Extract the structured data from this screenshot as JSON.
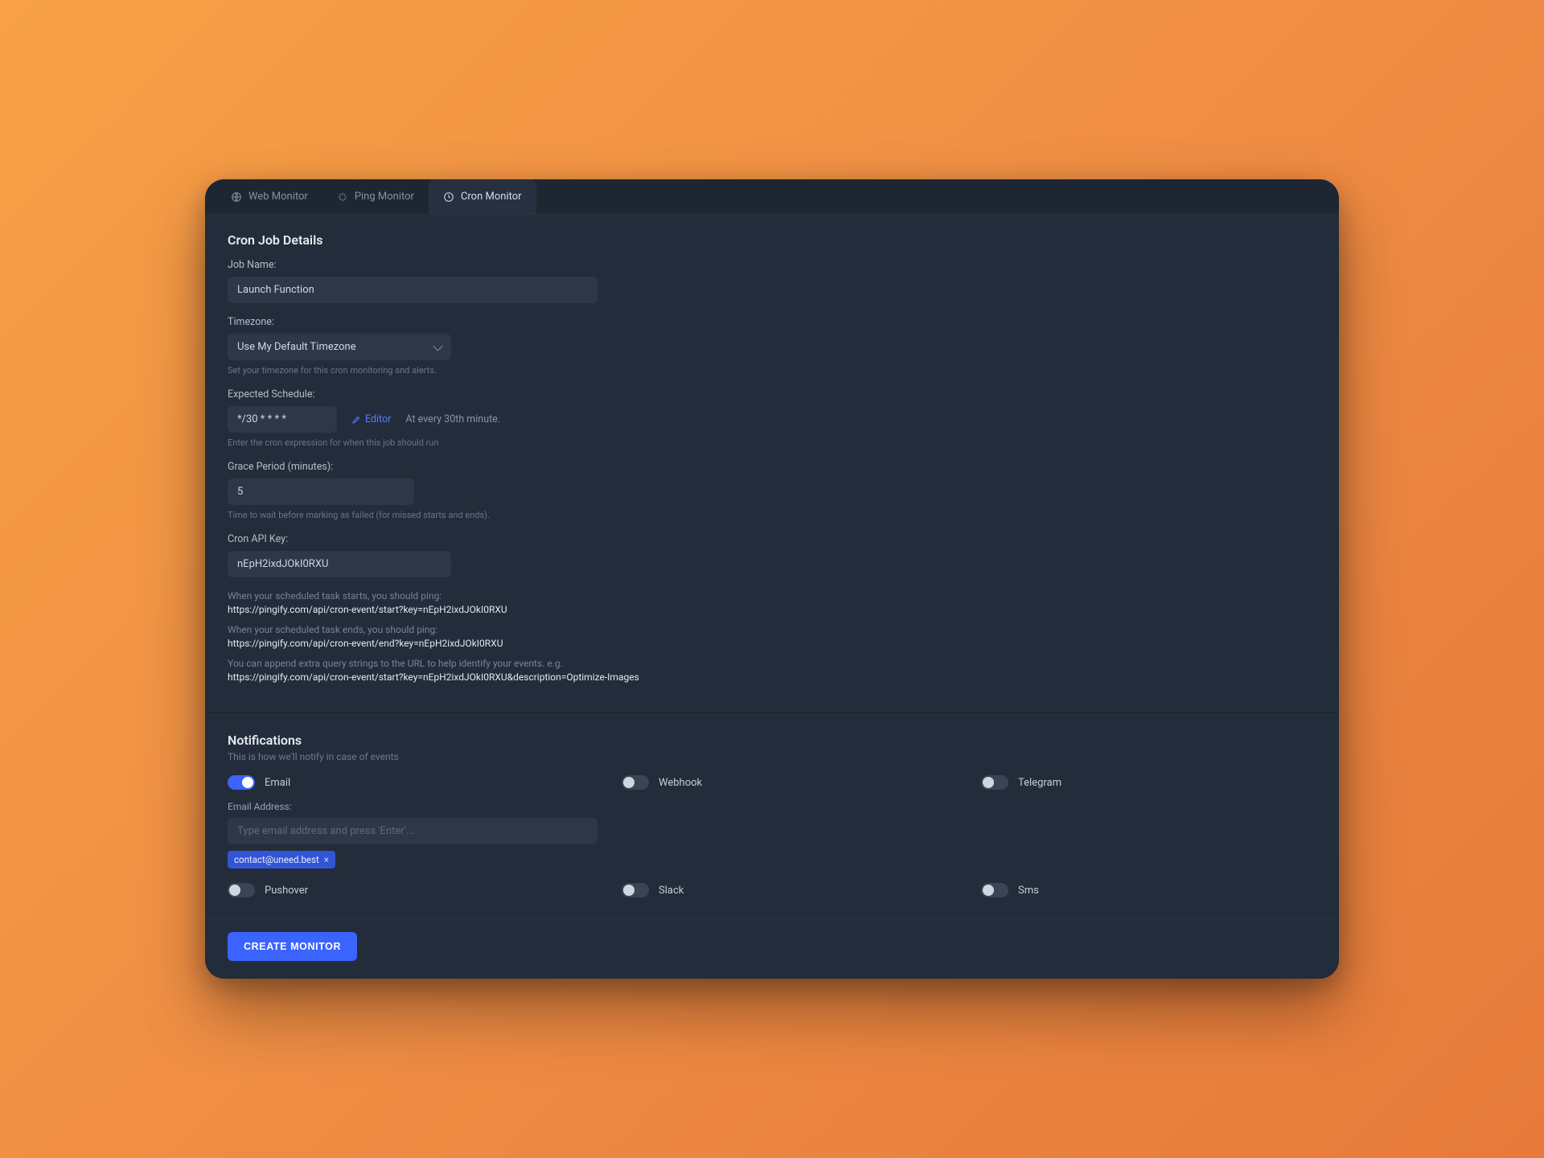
{
  "tabs": [
    {
      "label": "Web Monitor",
      "icon": "globe"
    },
    {
      "label": "Ping Monitor",
      "icon": "sparkle"
    },
    {
      "label": "Cron Monitor",
      "icon": "clock",
      "active": true
    }
  ],
  "details": {
    "heading": "Cron Job Details",
    "job_name": {
      "label": "Job Name:",
      "value": "Launch Function"
    },
    "timezone": {
      "label": "Timezone:",
      "selected": "Use My Default Timezone",
      "help": "Set your timezone for this cron monitoring and alerts."
    },
    "schedule": {
      "label": "Expected Schedule:",
      "value": "*/30 * * * *",
      "editor_link": "Editor",
      "description": "At every 30th minute.",
      "help": "Enter the cron expression for when this job should run"
    },
    "grace": {
      "label": "Grace Period (minutes):",
      "value": "5",
      "help": "Time to wait before marking as failed (for missed starts and ends)."
    },
    "api_key": {
      "label": "Cron API Key:",
      "value": "nEpH2ixdJOkI0RXU"
    },
    "api_info": {
      "start_label": "When your scheduled task starts, you should ping:",
      "start_url": "https://pingify.com/api/cron-event/start?key=nEpH2ixdJOkI0RXU",
      "end_label": "When your scheduled task ends, you should ping:",
      "end_url": "https://pingify.com/api/cron-event/end?key=nEpH2ixdJOkI0RXU",
      "extra_label": "You can append extra query strings to the URL to help identify your events. e.g.",
      "extra_url": "https://pingify.com/api/cron-event/start?key=nEpH2ixdJOkI0RXU&description=Optimize-Images"
    }
  },
  "notifications": {
    "heading": "Notifications",
    "subtitle": "This is how we'll notify in case of events",
    "channels": {
      "email": {
        "label": "Email",
        "on": true
      },
      "webhook": {
        "label": "Webhook",
        "on": false
      },
      "telegram": {
        "label": "Telegram",
        "on": false
      },
      "pushover": {
        "label": "Pushover",
        "on": false
      },
      "slack": {
        "label": "Slack",
        "on": false
      },
      "sms": {
        "label": "Sms",
        "on": false
      }
    },
    "email_field": {
      "label": "Email Address:",
      "placeholder": "Type email address and press 'Enter'...",
      "chips": [
        "contact@uneed.best"
      ]
    }
  },
  "footer": {
    "create_button": "CREATE MONITOR"
  }
}
